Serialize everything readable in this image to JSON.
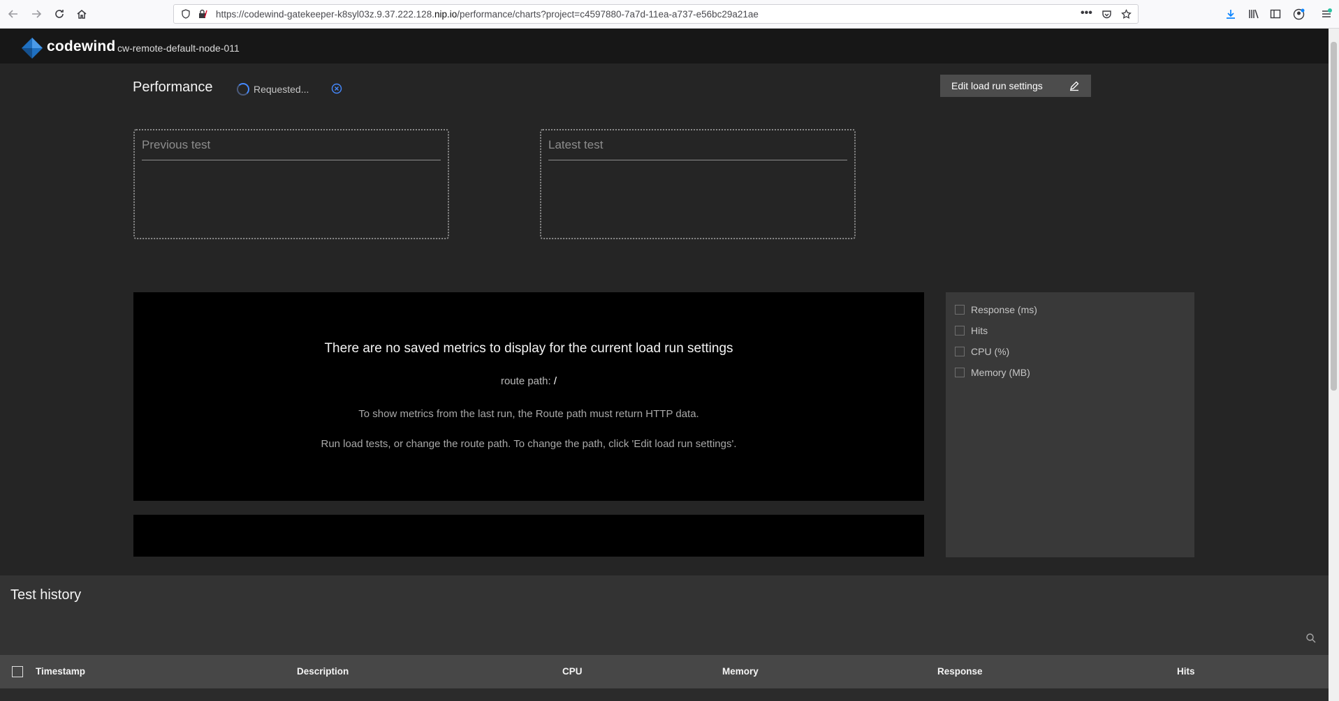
{
  "browser": {
    "url_prefix": "https://codewind-gatekeeper-k8syl03z.9.37.222.128.",
    "url_domain": "nip.io",
    "url_path": "/performance/charts?project=c4597880-7a7d-11ea-a737-e56bc29a21ae"
  },
  "header": {
    "brand": "codewind",
    "connection": "cw-remote-default-node-011"
  },
  "performance": {
    "title": "Performance",
    "status": "Requested...",
    "edit_button": "Edit load run settings"
  },
  "summary": {
    "previous_title": "Previous test",
    "latest_title": "Latest test"
  },
  "chart": {
    "no_data_title": "There are no saved metrics to display for the current load run settings",
    "route_label": "route path:",
    "route_value": "/",
    "hint_1": "To show metrics from the last run, the Route path must return HTTP data.",
    "hint_2": "Run load tests, or change the route path. To change the path, click 'Edit load run settings'."
  },
  "metrics": [
    "Response (ms)",
    "Hits",
    "CPU (%)",
    "Memory (MB)"
  ],
  "history": {
    "title": "Test history",
    "columns": [
      "Timestamp",
      "Description",
      "CPU",
      "Memory",
      "Response",
      "Hits"
    ]
  },
  "colors": {
    "accent": "#4589ff",
    "brand_blue": "#1f70c1",
    "panel_black": "#000000",
    "page_bg": "#252525"
  }
}
